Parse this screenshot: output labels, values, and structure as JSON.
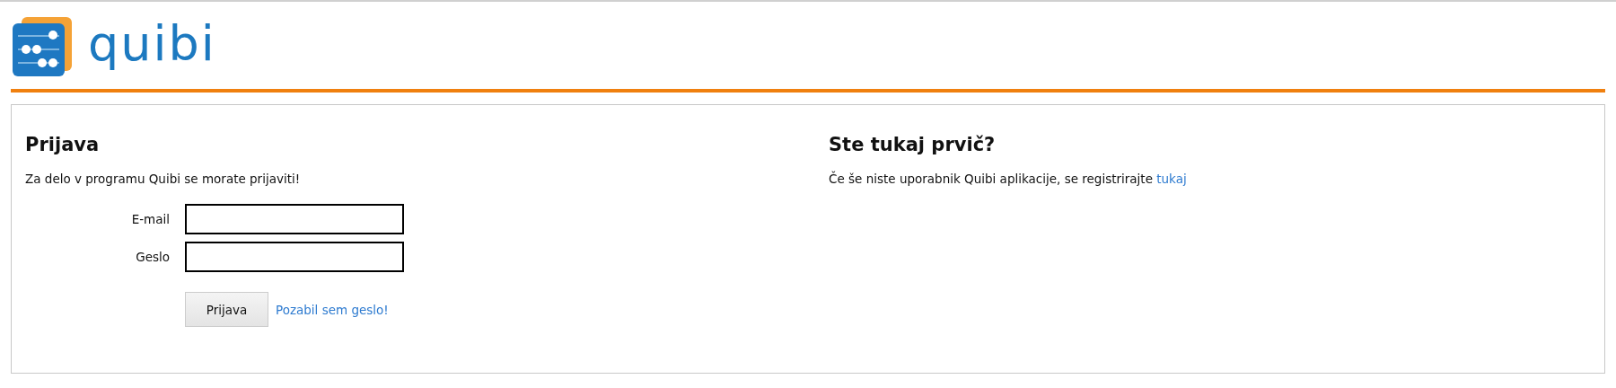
{
  "logo": {
    "text": "quibi"
  },
  "login": {
    "title": "Prijava",
    "intro": "Za delo v programu Quibi se morate prijaviti!",
    "fields": [
      {
        "label": "E-mail"
      },
      {
        "label": "Geslo"
      }
    ],
    "submit": "Prijava",
    "forgot_link": "Pozabil sem geslo!"
  },
  "register": {
    "title": "Ste tukaj prvič?",
    "text": "Če še niste uporabnik Quibi aplikacije, se registrirajte",
    "link": "tukaj"
  }
}
